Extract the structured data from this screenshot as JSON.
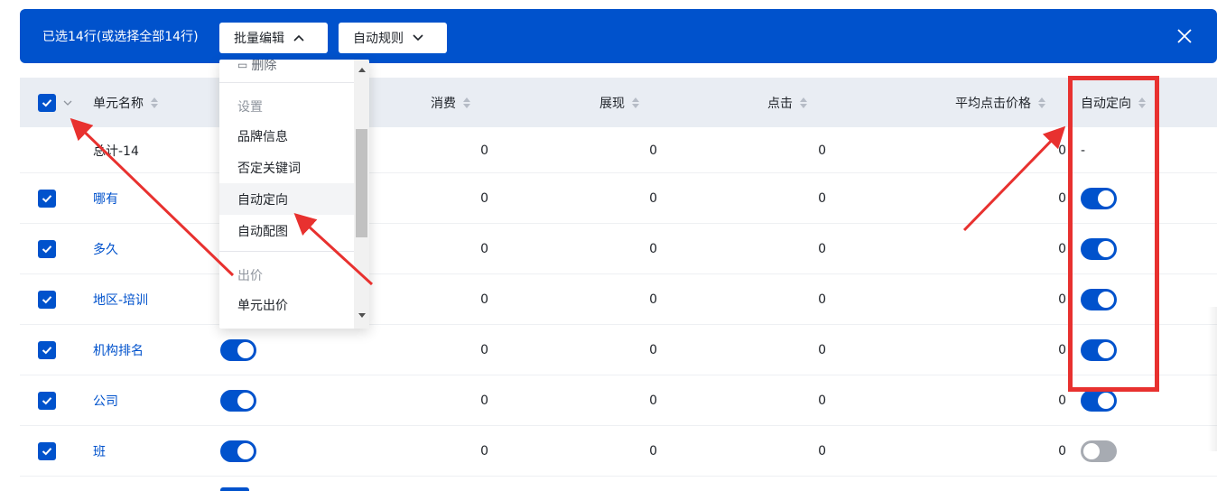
{
  "selection_bar": {
    "count_text": "已选14行(或选择全部14行)",
    "batch_edit_label": "批量编辑",
    "auto_rules_label": "自动规则"
  },
  "table": {
    "headers": {
      "name": "单元名称",
      "cost": "消费",
      "impressions": "展现",
      "clicks": "点击",
      "avg_cpc": "平均点击价格",
      "auto_targeting": "自动定向"
    },
    "total_row": {
      "name": "总计-14",
      "cost": "0",
      "impressions": "0",
      "clicks": "0",
      "avg_cpc": "0",
      "auto_targeting": "-"
    },
    "rows": [
      {
        "name": "哪有",
        "cost": "0",
        "impressions": "0",
        "clicks": "0",
        "avg_cpc": "0",
        "status_on": true,
        "auto_on": true
      },
      {
        "name": "多久",
        "cost": "0",
        "impressions": "0",
        "clicks": "0",
        "avg_cpc": "0",
        "status_on": true,
        "auto_on": true
      },
      {
        "name": "地区-培训",
        "cost": "0",
        "impressions": "0",
        "clicks": "0",
        "avg_cpc": "0",
        "status_on": true,
        "auto_on": true
      },
      {
        "name": "机构排名",
        "cost": "0",
        "impressions": "0",
        "clicks": "0",
        "avg_cpc": "0",
        "status_on": true,
        "auto_on": true
      },
      {
        "name": "公司",
        "cost": "0",
        "impressions": "0",
        "clicks": "0",
        "avg_cpc": "0",
        "status_on": true,
        "auto_on": true
      },
      {
        "name": "班",
        "cost": "0",
        "impressions": "0",
        "clicks": "0",
        "avg_cpc": "0",
        "status_on": true,
        "auto_on": false
      }
    ]
  },
  "dropdown": {
    "partial_top_item": "删除",
    "group_settings": "设置",
    "items_settings": [
      "品牌信息",
      "否定关键词",
      "自动定向",
      "自动配图"
    ],
    "group_bid": "出价",
    "items_bid": [
      "单元出价"
    ],
    "highlighted_item": "自动定向"
  },
  "colors": {
    "brand": "#0052cc",
    "header_bg": "#e9edf3",
    "annotation_red": "#e8312f",
    "toggle_off": "#a7abb2"
  }
}
